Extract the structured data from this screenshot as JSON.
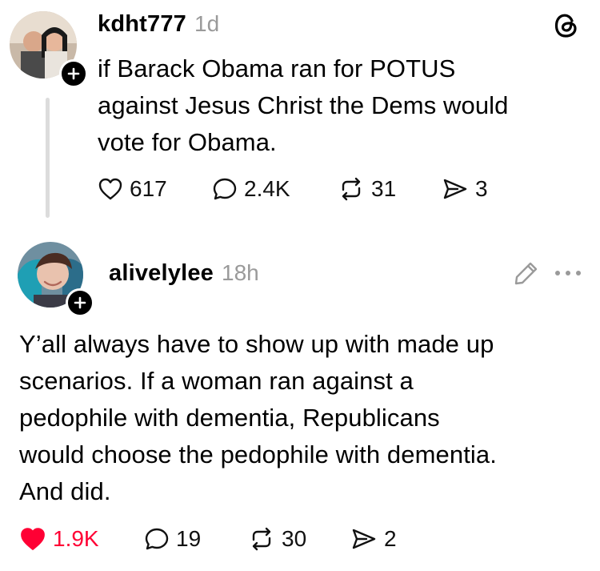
{
  "post1": {
    "username": "kdht777",
    "time": "1d",
    "text_lines": [
      "if Barack Obama ran for POTUS",
      "against Jesus Christ the Dems would",
      "vote for Obama."
    ],
    "actions": {
      "likes": "617",
      "replies": "2.4K",
      "reposts": "31",
      "shares": "3"
    },
    "logo_icon": "threads-icon"
  },
  "post2": {
    "username": "alivelylee",
    "time": "18h",
    "text_lines": [
      "Y’all always have to show up with made up",
      "scenarios. If a woman ran against a",
      "pedophile with dementia, Republicans",
      "would choose the pedophile with dementia.",
      "And did."
    ],
    "actions": {
      "likes": "1.9K",
      "replies": "19",
      "reposts": "30",
      "shares": "2"
    },
    "like_color": "#ff0034"
  }
}
